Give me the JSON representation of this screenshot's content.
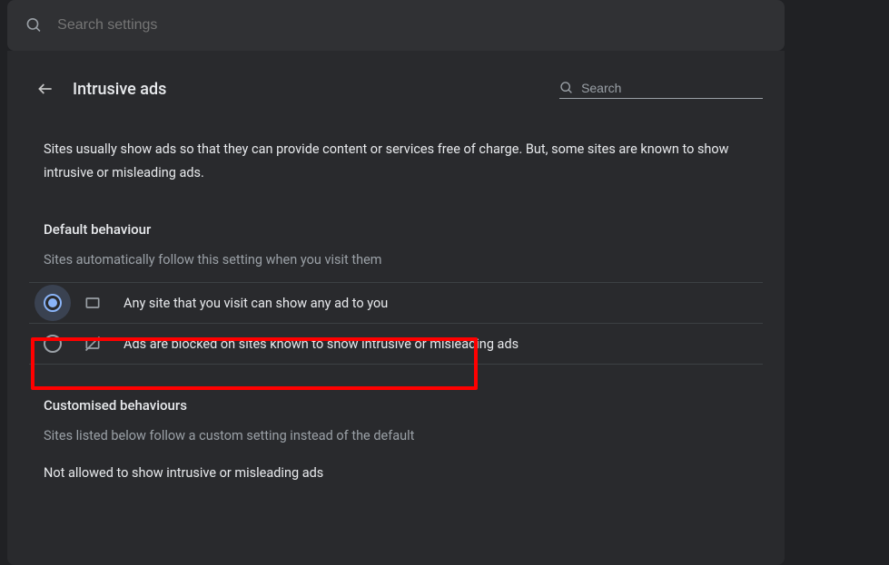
{
  "top_search": {
    "placeholder": "Search settings"
  },
  "header": {
    "title": "Intrusive ads",
    "search_placeholder": "Search"
  },
  "description": "Sites usually show ads so that they can provide content or services free of charge. But, some sites are known to show intrusive or misleading ads.",
  "default_behaviour": {
    "title": "Default behaviour",
    "subtitle": "Sites automatically follow this setting when you visit them",
    "options": [
      {
        "label": "Any site that you visit can show any ad to you",
        "selected": true
      },
      {
        "label": "Ads are blocked on sites known to show intrusive or misleading ads",
        "selected": false
      }
    ]
  },
  "customised": {
    "title": "Customised behaviours",
    "subtitle": "Sites listed below follow a custom setting instead of the default",
    "not_allowed_label": "Not allowed to show intrusive or misleading ads"
  }
}
